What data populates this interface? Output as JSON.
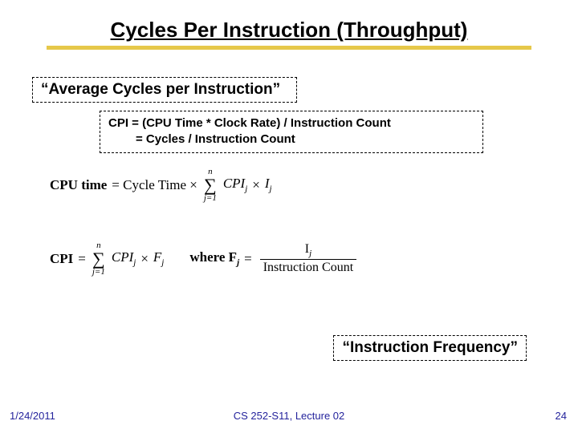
{
  "title": "Cycles Per Instruction (Throughput)",
  "box1": "“Average Cycles per Instruction”",
  "box2_line1": "CPI = (CPU Time * Clock Rate) / Instruction Count",
  "box2_line2": "=  Cycles / Instruction Count",
  "formula1": {
    "lhs": "CPU time",
    "eq": " = Cycle Time × ",
    "sigma_top": "n",
    "sigma_bot": "j=1",
    "term_a": "CPI",
    "term_a_sub": "j",
    "times": " × ",
    "term_b": "I",
    "term_b_sub": "j"
  },
  "formula2": {
    "lhs": "CPI",
    "eq": " = ",
    "sigma_top": "n",
    "sigma_bot": "j=1",
    "term_a": "CPI",
    "term_a_sub": "j",
    "times": " × ",
    "term_b": "F",
    "term_b_sub": "j",
    "where": "where  F",
    "where_sub": "j",
    "where_eq": " = ",
    "frac_num_a": "I",
    "frac_num_sub": "j",
    "frac_den": "Instruction Count"
  },
  "box3": "“Instruction Frequency”",
  "footer": {
    "date": "1/24/2011",
    "course": "CS 252-S11, Lecture 02",
    "page": "24"
  }
}
